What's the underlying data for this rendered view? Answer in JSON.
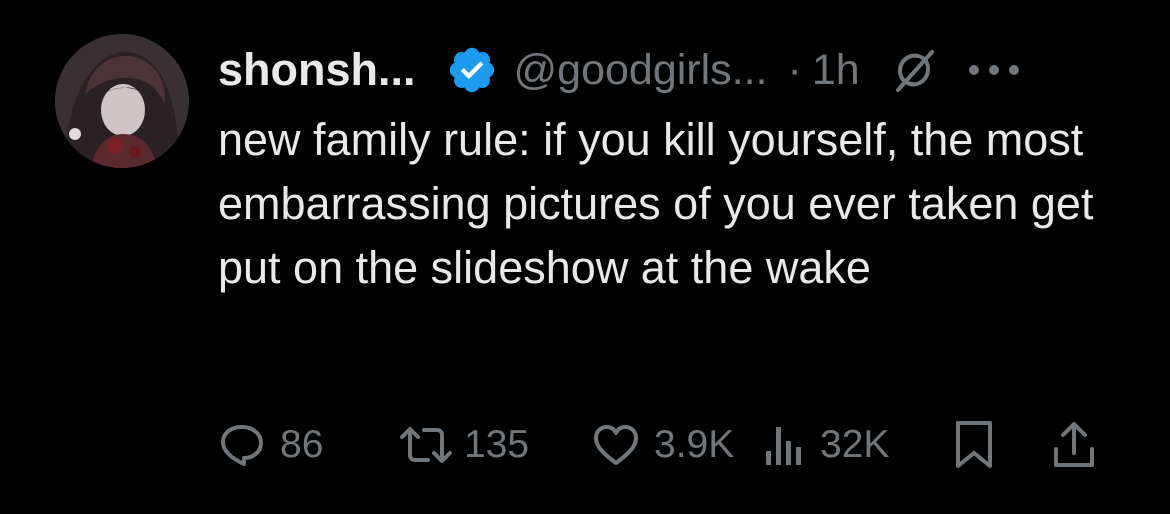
{
  "tweet": {
    "author_name": "shonsh...",
    "handle": "@goodgirls...",
    "separator": "·",
    "time": "1h",
    "text": "new family rule: if you kill yourself, the most embarrassing pictures of you ever taken get put on the slideshow at the wake"
  },
  "actions": {
    "replies": "86",
    "reposts": "135",
    "likes": "3.9K",
    "views": "32K"
  },
  "icons": {
    "verified": "verified-badge-icon",
    "grok": "grok-icon",
    "more": "more-options-icon",
    "reply": "reply-icon",
    "repost": "repost-icon",
    "like": "like-icon",
    "views": "views-icon",
    "bookmark": "bookmark-icon",
    "share": "share-icon"
  },
  "colors": {
    "background": "#000000",
    "text": "#e7e9ea",
    "muted": "#71767b",
    "verified": "#1d9bf0"
  }
}
